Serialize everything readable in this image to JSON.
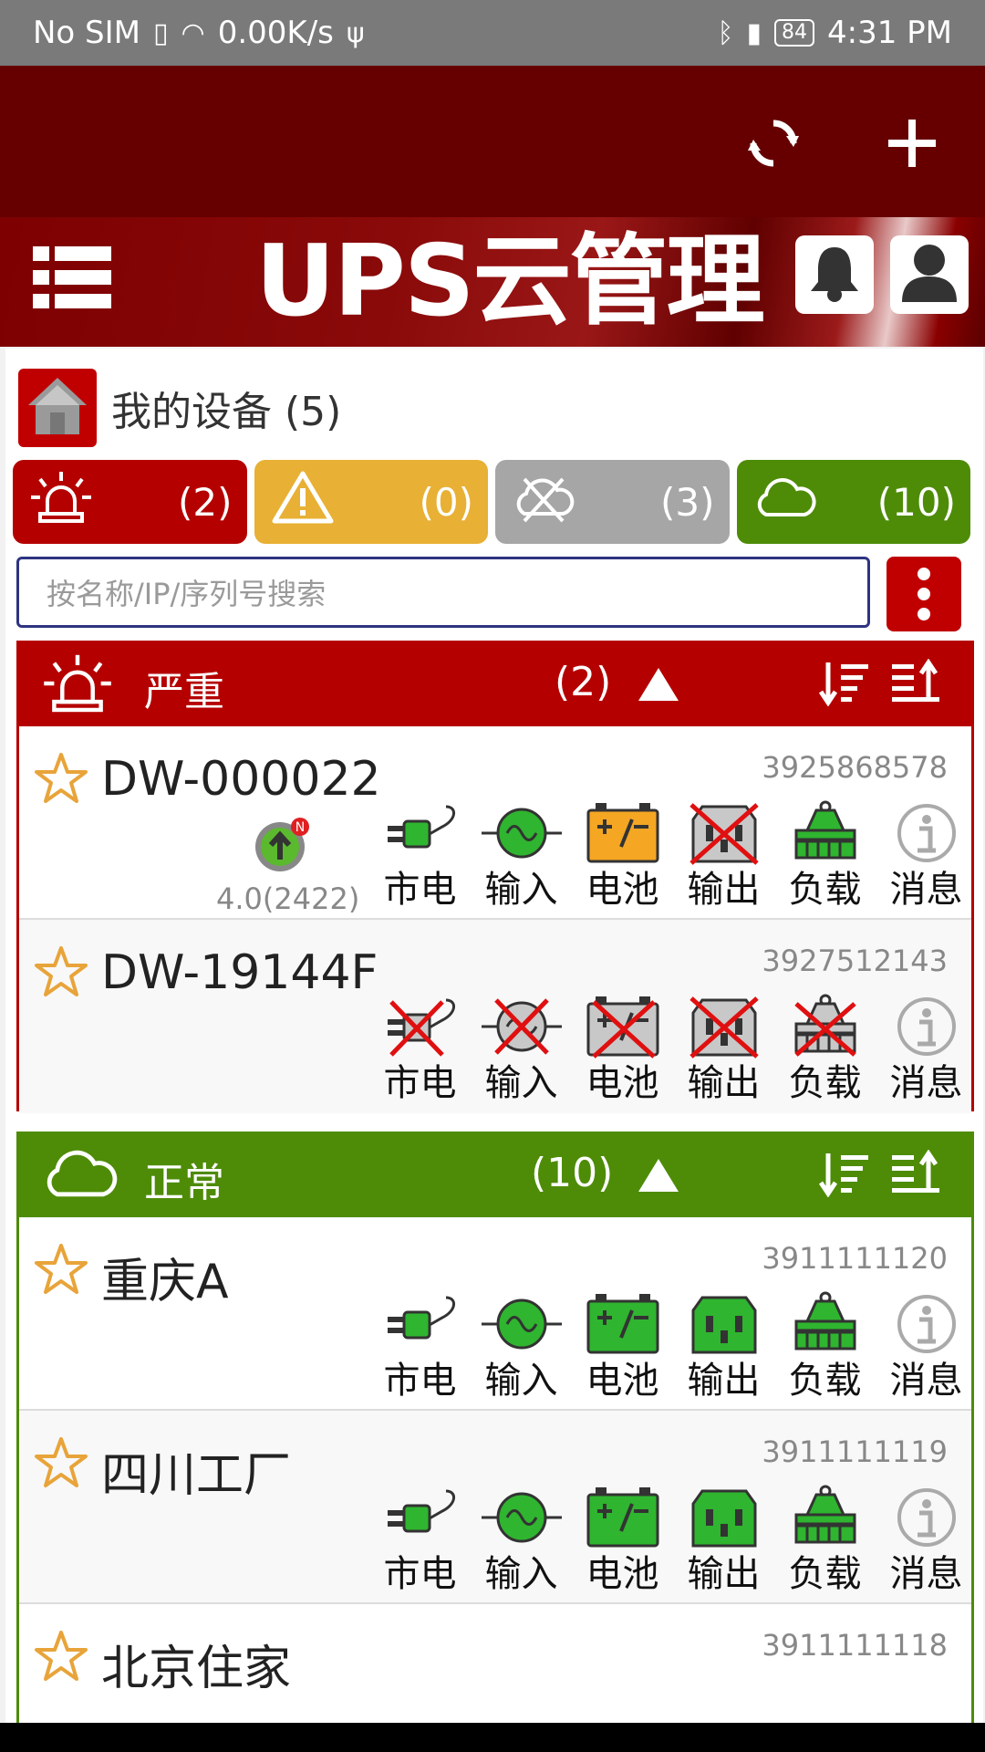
{
  "status_bar": {
    "carrier": "No SIM",
    "speed": "0.00K/s",
    "battery": "84",
    "time": "4:31 PM"
  },
  "banner": {
    "title": "UPS云管理"
  },
  "my_devices": {
    "label": "我的设备 (5)"
  },
  "filters": [
    {
      "count": "(2)",
      "color": "#b50000",
      "icon": "alarm-light-icon"
    },
    {
      "count": "(0)",
      "color": "#e8b034",
      "icon": "warning-icon"
    },
    {
      "count": "(3)",
      "color": "#a6a6a6",
      "icon": "disconnected-icon"
    },
    {
      "count": "(10)",
      "color": "#4e8c08",
      "icon": "cloud-icon"
    }
  ],
  "search": {
    "placeholder": "按名称/IP/序列号搜索"
  },
  "groups": {
    "critical": {
      "name": "严重",
      "count": "(2)",
      "color": "#b50000",
      "devices": [
        {
          "name": "DW-000022",
          "serial": "3925868578",
          "firmware": "4.0(2422)"
        },
        {
          "name": "DW-19144F",
          "serial": "3927512143"
        }
      ]
    },
    "normal": {
      "name": "正常",
      "count": "(10)",
      "color": "#4e8c08",
      "devices": [
        {
          "name": "重庆A",
          "serial": "3911111120"
        },
        {
          "name": "四川工厂",
          "serial": "3911111119"
        },
        {
          "name": "北京住家",
          "serial": "3911111118"
        }
      ]
    }
  },
  "stat_labels": {
    "mains": "市电",
    "input": "输入",
    "battery": "电池",
    "output": "输出",
    "load": "负载",
    "message": "消息"
  }
}
